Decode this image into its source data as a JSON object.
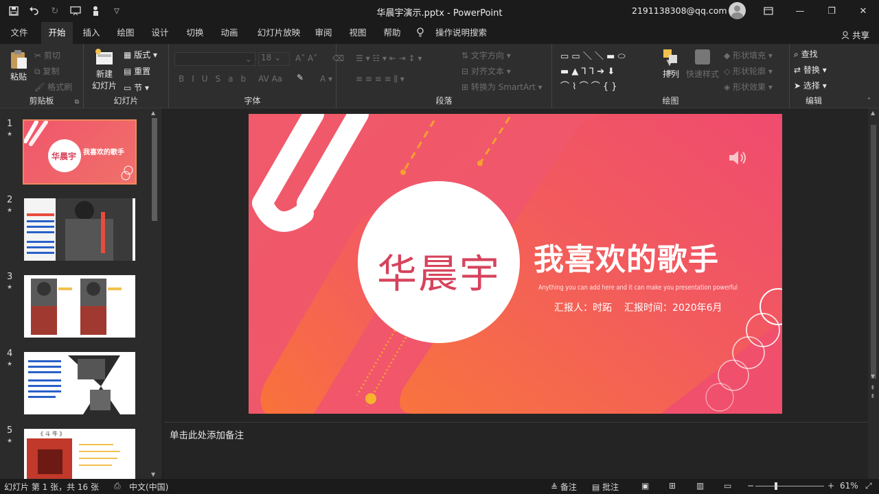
{
  "window": {
    "title": "华晨宇演示.pptx - PowerPoint",
    "account": "2191138308@qq.com"
  },
  "tabs": [
    "文件",
    "开始",
    "插入",
    "绘图",
    "设计",
    "切换",
    "动画",
    "幻灯片放映",
    "审阅",
    "视图",
    "帮助",
    "操作说明搜索"
  ],
  "active_tab": "开始",
  "share_label": "共享",
  "ribbon": {
    "clipboard": {
      "paste": "粘贴",
      "cut": "剪切",
      "copy": "复制",
      "format_painter": "格式刷",
      "label": "剪贴板"
    },
    "slides": {
      "new_slide_line1": "新建",
      "new_slide_line2": "幻灯片",
      "layout": "版式",
      "reset": "重置",
      "section": "节",
      "label": "幻灯片"
    },
    "font": {
      "label": "字体",
      "size": "18"
    },
    "paragraph": {
      "text_direction": "文字方向",
      "align_text": "对齐文本",
      "smartart": "转换为 SmartArt",
      "label": "段落"
    },
    "drawing": {
      "arrange": "排列",
      "quick_styles": "快速样式",
      "shape_fill": "形状填充",
      "shape_outline": "形状轮廓",
      "shape_effects": "形状效果",
      "label": "绘图"
    },
    "editing": {
      "find": "查找",
      "replace": "替换",
      "select": "选择",
      "label": "编辑"
    }
  },
  "thumbnails": [
    {
      "number": "1",
      "selected": true
    },
    {
      "number": "2",
      "selected": false
    },
    {
      "number": "3",
      "selected": false
    },
    {
      "number": "4",
      "selected": false
    },
    {
      "number": "5",
      "selected": false
    }
  ],
  "slide": {
    "name": "华晨宇",
    "title": "我喜欢的歌手",
    "subtitle": "Anything you can add here and it can make you presentation powerful",
    "reporter": "汇报人：时跖",
    "report_time": "汇报时间：2020年6月"
  },
  "thumb_text": {
    "t1_name": "华晨宇",
    "t1_title": "我喜欢的歌手",
    "t5_title": "《 斗 牛 》"
  },
  "notes_placeholder": "单击此处添加备注",
  "status": {
    "slide_info": "幻灯片 第 1 张，共 16 张",
    "language": "中文(中国)",
    "notes": "备注",
    "comments": "批注",
    "zoom": "61%"
  },
  "colors": {
    "accent": "#f05a6a",
    "orange": "#f7a12e"
  }
}
